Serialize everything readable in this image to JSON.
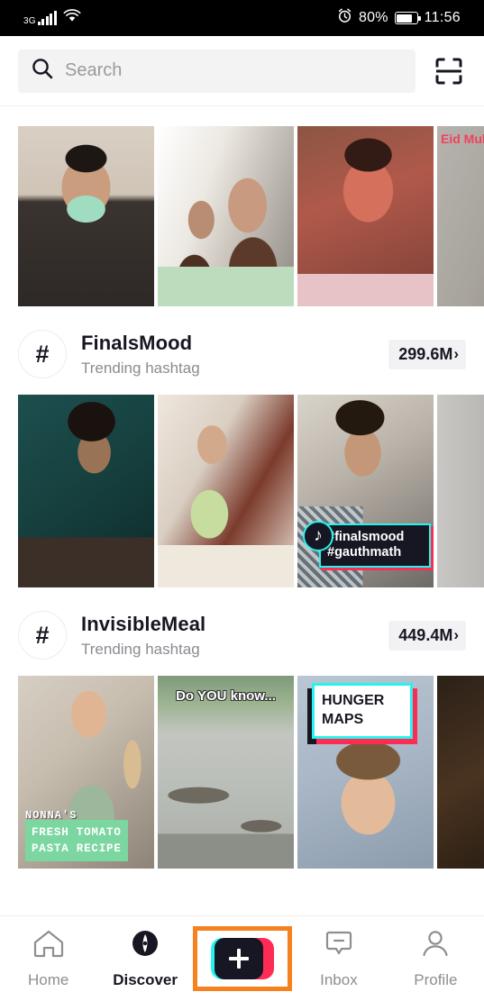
{
  "status_bar": {
    "network": "3G",
    "signal_icon": "signal-bars-icon",
    "wifi_icon": "wifi-icon",
    "alarm_icon": "alarm-clock-icon",
    "battery_percent": "80%",
    "battery_icon": "battery-icon",
    "time": "11:56"
  },
  "search": {
    "placeholder": "Search",
    "icon": "search-icon",
    "scan_icon": "qr-scan-icon"
  },
  "feed_rows": [
    {
      "id": "row-top-videos",
      "videos": [
        {
          "caption": "",
          "alt": "man wearing green surgical mask"
        },
        {
          "caption": "",
          "alt": "two women applying makeup indoors"
        },
        {
          "caption": "",
          "alt": "man in red-lit room holding blanket"
        },
        {
          "caption": "Eid Mubarak",
          "alt": "man in dark shirt in living room"
        }
      ]
    }
  ],
  "hashtag_sections": [
    {
      "icon": "hashtag-icon",
      "name": "FinalsMood",
      "subtitle": "Trending hashtag",
      "views": "299.6M",
      "chevron": "›",
      "videos": [
        {
          "overlay": null,
          "alt": "man with glasses studying at desk"
        },
        {
          "overlay": null,
          "alt": "woman in green dress reading a book"
        },
        {
          "overlay": {
            "type": "tag-box",
            "badge": "tiktok-note-icon",
            "lines": [
              "#finalsmood",
              "#gauthmath"
            ]
          },
          "alt": "man with red lipstick holding paper"
        },
        {
          "overlay": null,
          "alt": "person in colorful dress by a wall"
        }
      ]
    },
    {
      "icon": "hashtag-icon",
      "name": "InvisibleMeal",
      "subtitle": "Trending hashtag",
      "views": "449.4M",
      "chevron": "›",
      "videos": [
        {
          "overlay": {
            "type": "nonna",
            "title": "NONNA'S",
            "lines": [
              "FRESH TOMATO",
              "PASTA RECIPE"
            ]
          },
          "alt": "woman in kitchen wearing green apron"
        },
        {
          "overlay": {
            "type": "doyouknow",
            "text": "Do YOU know..."
          },
          "alt": "aerial view of flooded village"
        },
        {
          "overlay": {
            "type": "hunger",
            "lines": [
              "HUNGER",
              "MAPS"
            ]
          },
          "alt": "woman looking up with hand on chin"
        },
        {
          "overlay": null,
          "alt": "close-up of fried food"
        }
      ]
    }
  ],
  "bottom_nav": {
    "items": [
      {
        "label": "Home",
        "icon": "home-icon",
        "active": false
      },
      {
        "label": "Discover",
        "icon": "compass-icon",
        "active": true
      },
      {
        "label": "",
        "icon": "plus-create-icon",
        "active": false,
        "highlighted": true
      },
      {
        "label": "Inbox",
        "icon": "inbox-message-icon",
        "active": false
      },
      {
        "label": "Profile",
        "icon": "person-icon",
        "active": false
      }
    ]
  },
  "colors": {
    "tiktok_cyan": "#25f4ee",
    "tiktok_pink": "#fe2c55",
    "dark": "#161722",
    "highlight_orange": "#f5821f",
    "muted_text": "#8a8b91",
    "pill_bg": "#f2f2f4"
  }
}
